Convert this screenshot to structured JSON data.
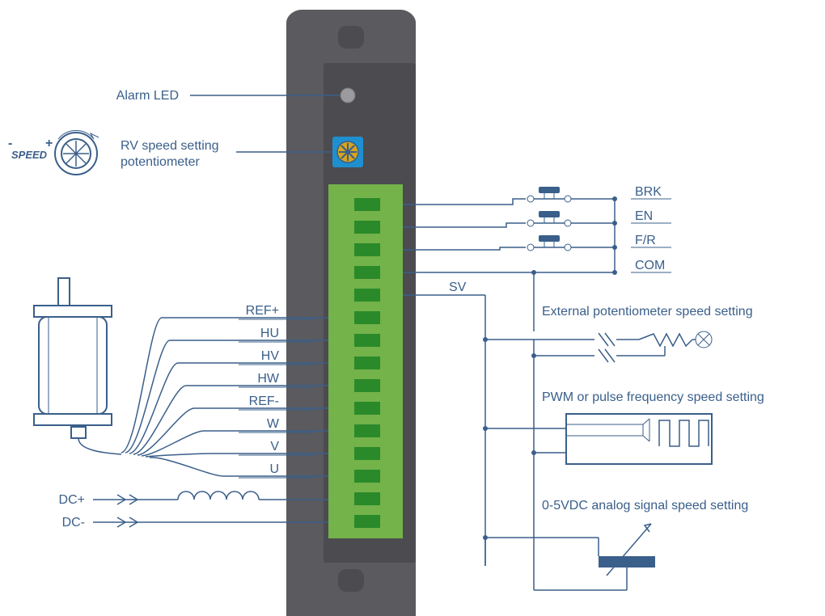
{
  "left_labels": {
    "alarm": "Alarm LED",
    "speed_knob_line1": "RV speed setting",
    "speed_knob_line2": "potentiometer",
    "speed_icon": "SPEED"
  },
  "terminal_labels": {
    "ref_plus": "REF+",
    "hu": "HU",
    "hv": "HV",
    "hw": "HW",
    "ref_minus": "REF-",
    "w": "W",
    "v": "V",
    "u": "U"
  },
  "power": {
    "dc_plus": "DC+",
    "dc_minus": "DC-"
  },
  "right_signals": {
    "brk": "BRK",
    "en": "EN",
    "fr": "F/R",
    "com": "COM",
    "sv": "SV"
  },
  "right_descriptions": {
    "ext_pot": "External potentiometer speed setting",
    "pwm": "PWM or pulse frequency speed setting",
    "analog": "0-5VDC analog signal speed setting"
  }
}
